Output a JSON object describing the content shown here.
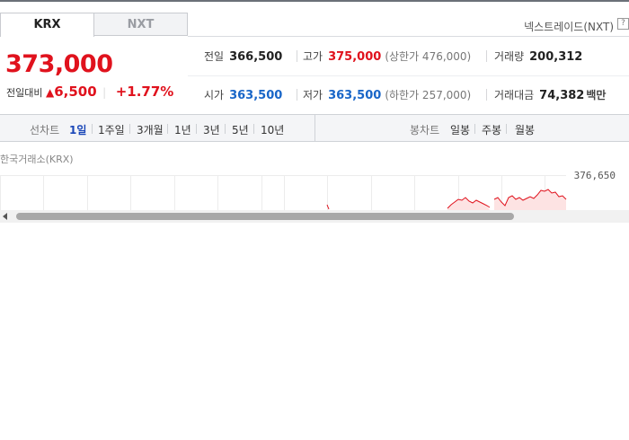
{
  "market_tabs": [
    {
      "label": "KRX",
      "active": true
    },
    {
      "label": "NXT",
      "active": false
    }
  ],
  "nxt_link_label": "넥스트레이드(NXT)",
  "help_icon_glyph": "?",
  "price": {
    "current": "373,000",
    "change_label": "전일대비",
    "change_symbol": "▲",
    "change_amount": "6,500",
    "change_percent": "+1.77%"
  },
  "stats": {
    "prev_close": {
      "label": "전일",
      "value": "366,500"
    },
    "high": {
      "label": "고가",
      "value": "375,000",
      "extra": "(상한가 476,000)"
    },
    "volume": {
      "label": "거래량",
      "value": "200,312"
    },
    "open": {
      "label": "시가",
      "value": "363,500"
    },
    "low": {
      "label": "저가",
      "value": "363,500",
      "extra": "(하한가 257,000)"
    },
    "trade_value": {
      "label": "거래대금",
      "value": "74,382",
      "unit": "백만"
    }
  },
  "toolbar": {
    "line_chart_title": "선차트",
    "periods": [
      "1일",
      "1주일",
      "3개월",
      "1년",
      "3년",
      "5년",
      "10년"
    ],
    "selected_period": "1일",
    "candle_chart_title": "봉차트",
    "candle_periods": [
      "일봉",
      "주봉",
      "월봉"
    ]
  },
  "chart": {
    "exchange_label": "한국거래소(KRX)",
    "max_label": "376,650",
    "line_color": "#e0121d",
    "fill_color": "#fde3e3"
  },
  "colors": {
    "up": "#e0121d",
    "down": "#1966c8",
    "selected": "#1a47b8"
  }
}
